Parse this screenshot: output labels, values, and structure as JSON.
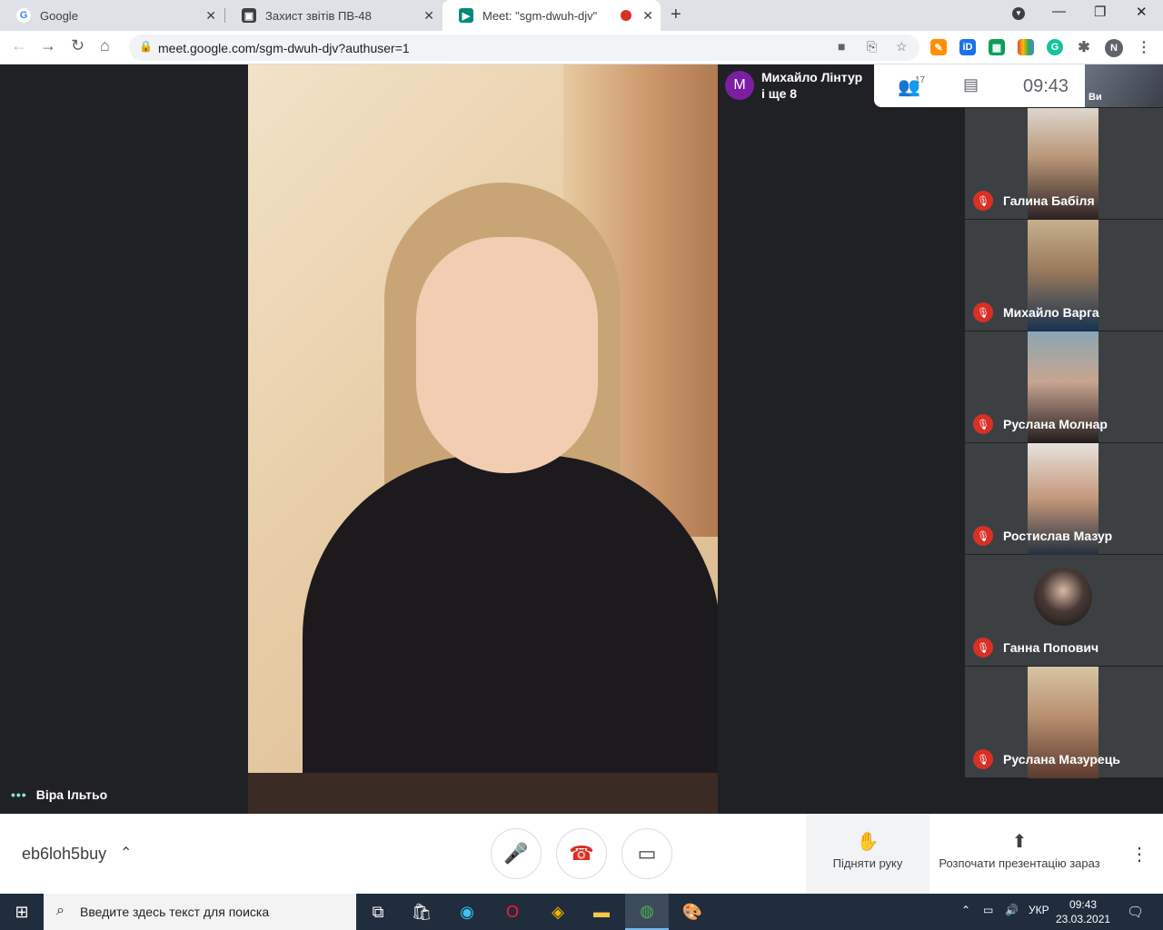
{
  "browser": {
    "tabs": [
      {
        "label": "Google",
        "favicon": "google-icon"
      },
      {
        "label": "Захист звітів ПВ-48",
        "favicon": "classroom-icon"
      },
      {
        "label": "Meet: \"sgm-dwuh-djv\"",
        "favicon": "meet-icon",
        "active": true
      }
    ],
    "url": "meet.google.com/sgm-dwuh-djv?authuser=1",
    "profile_initial": "N"
  },
  "meet": {
    "main_speaker": "Віра Ільтьо",
    "presenter_avatar": "M",
    "presenter_line1": "Михайло Лінтур",
    "presenter_line2": "і ще 8",
    "participant_count": "17",
    "time": "09:43",
    "top_thumb_label": "Ви",
    "participants": [
      {
        "name": "Галина Бабіля",
        "muted": true
      },
      {
        "name": "Михайло Варга",
        "muted": true
      },
      {
        "name": "Руслана Молнар",
        "muted": true
      },
      {
        "name": "Ростислав Мазур",
        "muted": true
      },
      {
        "name": "Ганна Попович",
        "muted": true
      },
      {
        "name": "Руслана Мазурець",
        "muted": true
      }
    ],
    "meeting_code": "eb6loh5buy",
    "raise_hand_label": "Підняти руку",
    "present_label": "Розпочати презентацію зараз"
  },
  "taskbar": {
    "search_placeholder": "Введите здесь текст для поиска",
    "language": "УКР",
    "clock_time": "09:43",
    "clock_date": "23.03.2021"
  }
}
